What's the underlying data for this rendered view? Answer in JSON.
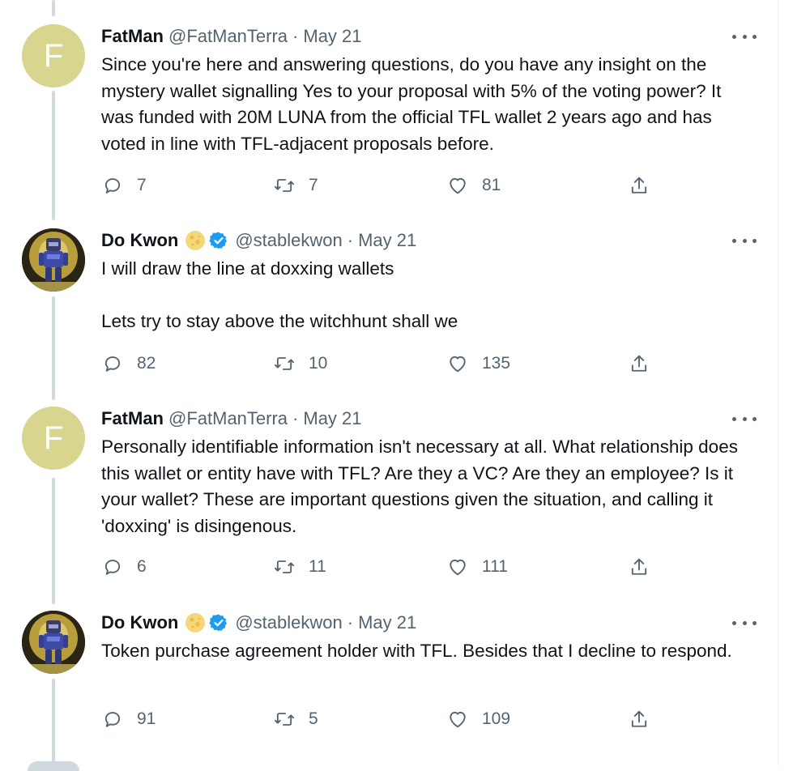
{
  "tweets": [
    {
      "author": "FatMan",
      "handle": "@FatManTerra",
      "separator": "·",
      "date": "May 21",
      "avatar_letter": "F",
      "verified": false,
      "text": "Since you're here and answering questions, do you have any insight on the mystery wallet signalling Yes to your proposal with 5% of the voting power? It was funded with 20M LUNA from the official TFL wallet 2 years ago and has voted in line with TFL-adjacent proposals before.",
      "replies": "7",
      "retweets": "7",
      "likes": "81"
    },
    {
      "author": "Do Kwon",
      "handle": "@stablekwon",
      "separator": "·",
      "date": "May 21",
      "verified": true,
      "text": "I will draw the line at doxxing wallets\n\nLets try to stay above the witchhunt shall we",
      "replies": "82",
      "retweets": "10",
      "likes": "135"
    },
    {
      "author": "FatMan",
      "handle": "@FatManTerra",
      "separator": "·",
      "date": "May 21",
      "avatar_letter": "F",
      "verified": false,
      "text": "Personally identifiable information isn't necessary at all. What relationship does this wallet or entity have with TFL? Are they a VC? Are they an employee? Is it your wallet? These are important questions given the situation, and calling it 'doxxing' is disingenous.",
      "replies": "6",
      "retweets": "11",
      "likes": "111"
    },
    {
      "author": "Do Kwon",
      "handle": "@stablekwon",
      "separator": "·",
      "date": "May 21",
      "verified": true,
      "text": "Token purchase agreement holder with TFL. Besides that I decline to respond.",
      "replies": "91",
      "retweets": "5",
      "likes": "109"
    }
  ],
  "colors": {
    "text": "#0f1419",
    "secondary": "#536471",
    "verified": "#1d9bf0",
    "thread_line": "#cfd9de",
    "fatman_avatar": "#d8d58f"
  },
  "icons": [
    "reply-icon",
    "retweet-icon",
    "like-icon",
    "share-icon",
    "more-icon",
    "verified-badge-icon",
    "moon-emoji-icon"
  ]
}
